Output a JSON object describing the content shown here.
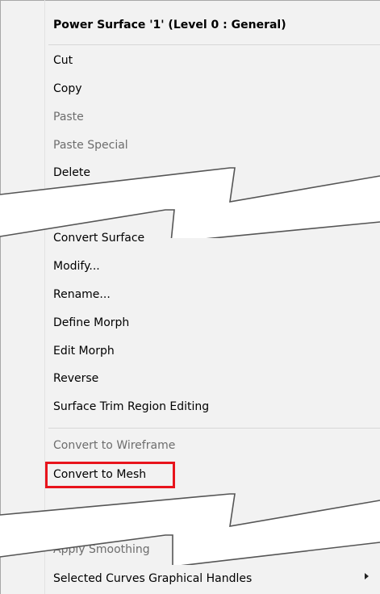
{
  "menu": {
    "header": "Power Surface '1' (Level 0 : General)",
    "group1": [
      {
        "label": "Cut",
        "enabled": true
      },
      {
        "label": "Copy",
        "enabled": true
      },
      {
        "label": "Paste",
        "enabled": false
      },
      {
        "label": "Paste Special",
        "enabled": false
      },
      {
        "label": "Delete",
        "enabled": true
      }
    ],
    "group2": [
      {
        "label": "Convert Surface",
        "enabled": true
      },
      {
        "label": "Modify...",
        "enabled": true
      },
      {
        "label": "Rename...",
        "enabled": true
      },
      {
        "label": "Define Morph",
        "enabled": true
      },
      {
        "label": "Edit Morph",
        "enabled": true
      },
      {
        "label": "Reverse",
        "enabled": true
      },
      {
        "label": "Surface Trim Region Editing",
        "enabled": true
      }
    ],
    "group3": [
      {
        "label": "Convert to Wireframe",
        "enabled": false
      },
      {
        "label": "Convert to Mesh",
        "enabled": true,
        "highlighted": true
      }
    ],
    "group4": [
      {
        "label": "Apply Smoothing",
        "enabled": false
      },
      {
        "label": "Selected Curves Graphical Handles",
        "enabled": true,
        "submenu": true
      }
    ]
  },
  "icons": {
    "submenu_arrow": "chevron-right-icon"
  },
  "colors": {
    "highlight_border": "#e8141c",
    "menu_background": "#f2f2f2",
    "disabled_text": "#6d6d6d"
  }
}
